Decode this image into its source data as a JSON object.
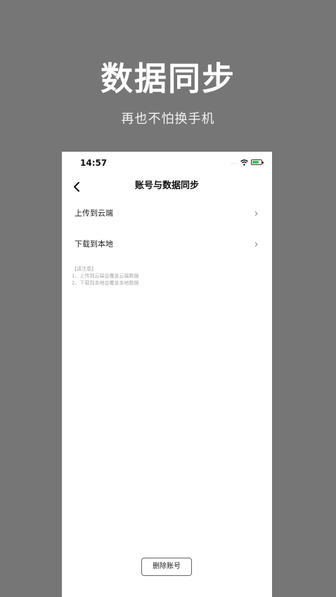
{
  "hero": {
    "title": "数据同步",
    "subtitle": "再也不怕换手机"
  },
  "status_bar": {
    "time": "14:57",
    "signal": "....",
    "icons": [
      "wifi-icon",
      "battery-charging-icon"
    ],
    "battery_color": "#3fc35a"
  },
  "nav": {
    "title": "账号与数据同步",
    "back_icon": "chevron-left-icon"
  },
  "menu": {
    "items": [
      {
        "label": "上传到云端",
        "icon": "chevron-right-icon"
      },
      {
        "label": "下载到本地",
        "icon": "chevron-right-icon"
      }
    ]
  },
  "note": {
    "heading": "【请注意】",
    "lines": [
      "1、上传到云端会覆盖云端数据",
      "2、下载到本地会覆盖本地数据"
    ]
  },
  "footer": {
    "delete_label": "删除账号"
  },
  "colors": {
    "background": "#767676",
    "card": "#ffffff"
  }
}
